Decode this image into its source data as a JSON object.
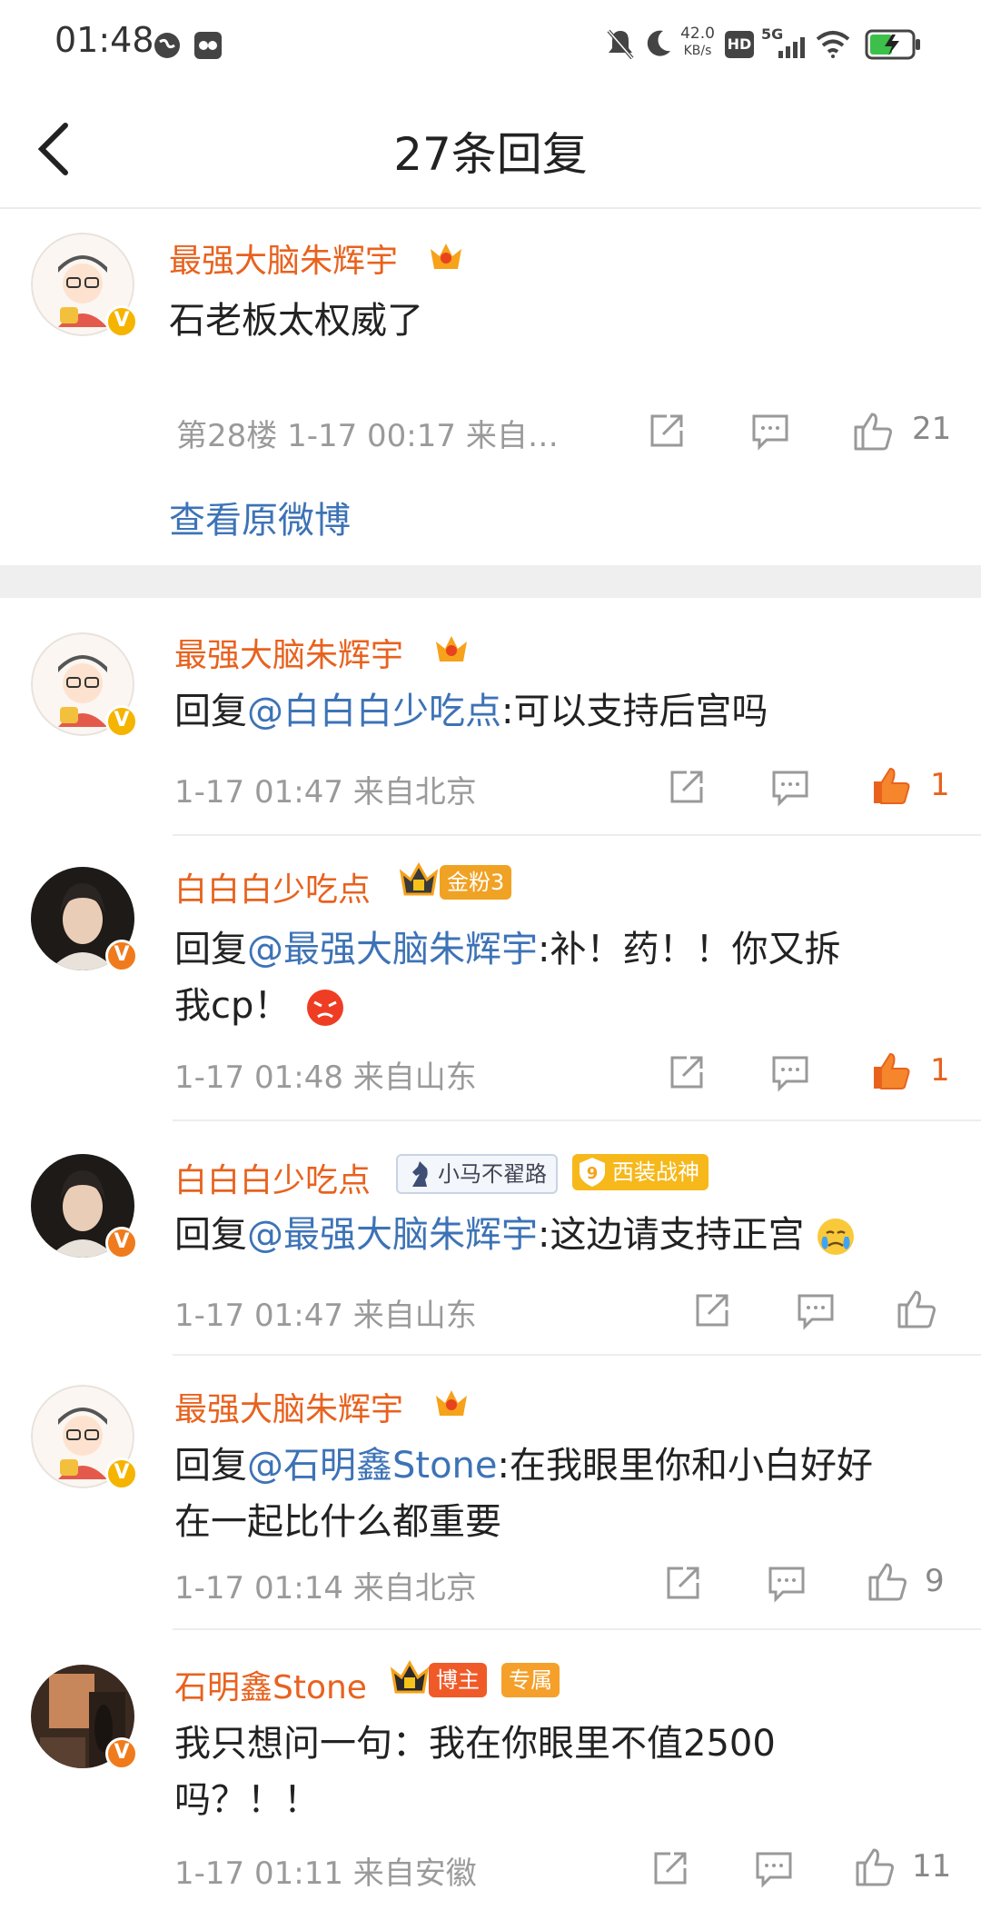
{
  "status_bar": {
    "time": "01:48",
    "net_speed_top": "42.0",
    "net_speed_unit": "KB/s",
    "hd": "HD",
    "signal": "5G"
  },
  "nav": {
    "title": "27条回复"
  },
  "main": {
    "username": "最强大脑朱辉宇",
    "text": "石老板太权威了",
    "meta": "第28楼 1-17 00:17 来自…",
    "likes": "21",
    "view_original": "查看原微博"
  },
  "replies": [
    {
      "username": "最强大脑朱辉宇",
      "reply_prefix": "回复",
      "mention": "@白白白少吃点",
      "text": ":可以支持后宫吗",
      "meta": "1-17 01:47 来自北京",
      "likes": "1",
      "liked": true
    },
    {
      "username": "白白白少吃点",
      "badge_fans": "金粉3",
      "reply_prefix": "回复",
      "mention": "@最强大脑朱辉宇",
      "text": ":补！药！！你又拆",
      "text2": "我cp！",
      "meta": "1-17 01:48 来自山东",
      "likes": "1",
      "liked": true
    },
    {
      "username": "白白白少吃点",
      "badge_horse": "小马不翟路",
      "badge_suit_num": "9",
      "badge_suit": "西装战神",
      "reply_prefix": "回复",
      "mention": "@最强大脑朱辉宇",
      "text": ":这边请支持正宫",
      "meta": "1-17 01:47 来自山东",
      "likes": "",
      "liked": false
    },
    {
      "username": "最强大脑朱辉宇",
      "reply_prefix": "回复",
      "mention": "@石明鑫Stone",
      "text": ":在我眼里你和小白好好",
      "text2": "在一起比什么都重要",
      "meta": "1-17 01:14 来自北京",
      "likes": "9",
      "liked": false
    },
    {
      "username": "石明鑫Stone",
      "badge_blogger": "博主",
      "badge_exclusive": "专属",
      "text": "我只想问一句：我在你眼里不值2500",
      "text2": "吗？！！",
      "meta": "1-17 01:11 来自安徽",
      "likes": "11",
      "liked": false
    }
  ],
  "colors": {
    "username": "#e8621e",
    "mention": "#3d73b6",
    "meta": "#9a9a9a",
    "like_active": "#e8621e",
    "divider": "#efefef"
  }
}
